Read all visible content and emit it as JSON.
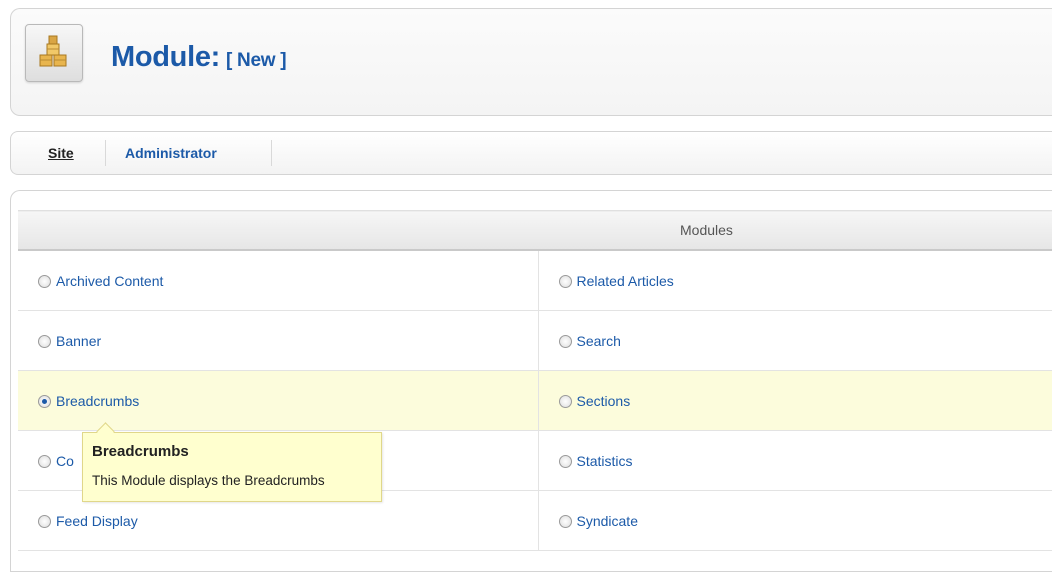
{
  "header": {
    "title": "Module:",
    "subtitle": "[ New ]",
    "icon": "module-box-icon"
  },
  "submenu": {
    "items": [
      {
        "label": "Site",
        "active": true
      },
      {
        "label": "Administrator",
        "active": false
      }
    ]
  },
  "modules": {
    "heading": "Modules",
    "rows": [
      {
        "left": {
          "label": "Archived Content",
          "selected": false
        },
        "right": {
          "label": "Related Articles",
          "selected": false
        }
      },
      {
        "left": {
          "label": "Banner",
          "selected": false
        },
        "right": {
          "label": "Search",
          "selected": false
        }
      },
      {
        "left": {
          "label": "Breadcrumbs",
          "selected": true
        },
        "right": {
          "label": "Sections",
          "selected": false
        }
      },
      {
        "left": {
          "label": "Co",
          "selected": false
        },
        "right": {
          "label": "Statistics",
          "selected": false
        }
      },
      {
        "left": {
          "label": "Feed Display",
          "selected": false
        },
        "right": {
          "label": "Syndicate",
          "selected": false
        }
      }
    ]
  },
  "tooltip": {
    "title": "Breadcrumbs",
    "description": "This Module displays the Breadcrumbs"
  },
  "colors": {
    "link": "#1c5aa8",
    "selected_row": "#fcfcdc",
    "tooltip_bg": "#ffffcf"
  }
}
